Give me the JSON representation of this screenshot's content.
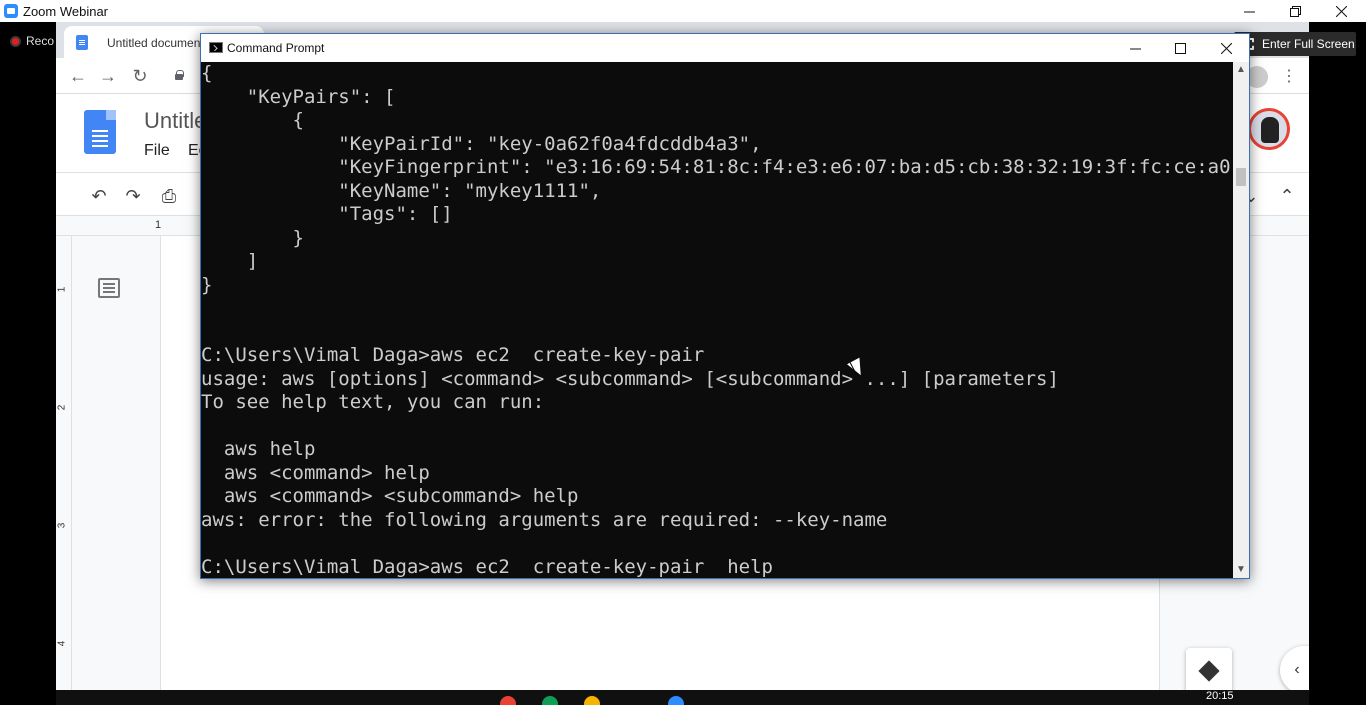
{
  "zoom": {
    "window_title": "Zoom Webinar",
    "recording_label": "Reco",
    "fullscreen_label": "Enter Full Screen"
  },
  "browser": {
    "tab_title": "Untitled document",
    "docs_title": "Untitle",
    "menu_file": "File",
    "menu_edit": "Ec",
    "ruler_label": "1",
    "vruler_labels": [
      "1",
      "2",
      "3",
      "4"
    ]
  },
  "cmd": {
    "window_title": "Command Prompt",
    "lines": [
      "{",
      "    \"KeyPairs\": [",
      "        {",
      "            \"KeyPairId\": \"key-0a62f0a4fdcddb4a3\",",
      "            \"KeyFingerprint\": \"e3:16:69:54:81:8c:f4:e3:e6:07:ba:d5:cb:38:32:19:3f:fc:ce:a0\",",
      "            \"KeyName\": \"mykey1111\",",
      "            \"Tags\": []",
      "        }",
      "    ]",
      "}",
      "",
      "",
      "C:\\Users\\Vimal Daga>aws ec2  create-key-pair",
      "usage: aws [options] <command> <subcommand> [<subcommand> ...] [parameters]",
      "To see help text, you can run:",
      "",
      "  aws help",
      "  aws <command> help",
      "  aws <command> <subcommand> help",
      "aws: error: the following arguments are required: --key-name",
      "",
      "C:\\Users\\Vimal Daga>aws ec2  create-key-pair  help"
    ]
  },
  "taskbar": {
    "time": "20:15"
  }
}
